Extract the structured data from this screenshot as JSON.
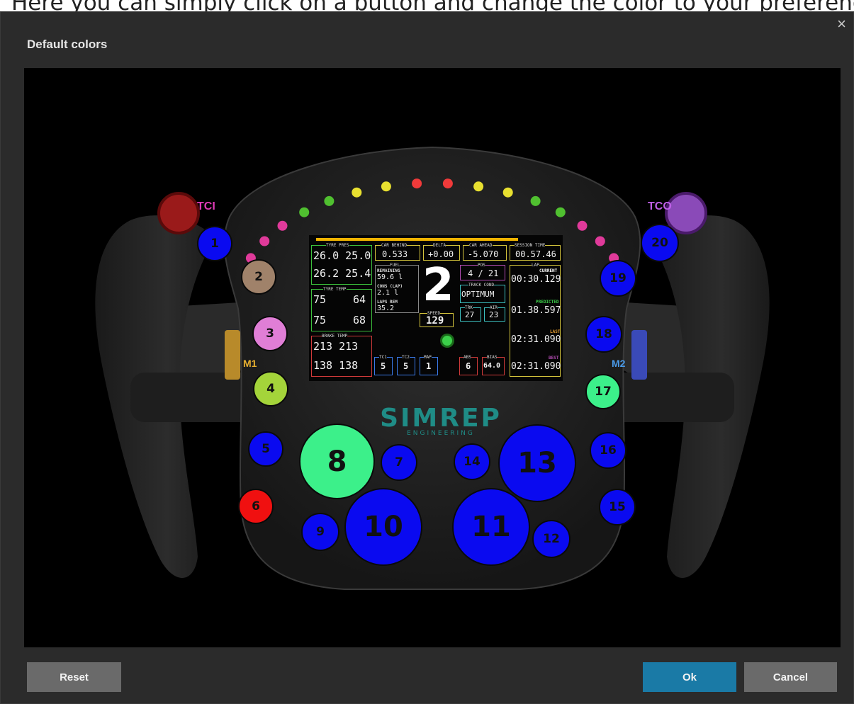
{
  "caption": "Here you can simply click on a button and change the color to your preference.",
  "dialog": {
    "title": "Default colors",
    "close": "×",
    "reset_label": "Reset",
    "ok_label": "Ok",
    "cancel_label": "Cancel",
    "ok_color": "#1a7aa6"
  },
  "labels": {
    "tci": "TCI",
    "tco": "TCO",
    "m1": "M1",
    "m2": "M2"
  },
  "buttons": [
    {
      "label": "1",
      "color": "#0a0af0"
    },
    {
      "label": "2",
      "color": "#a0826a"
    },
    {
      "label": "3",
      "color": "#e07ed6"
    },
    {
      "label": "4",
      "color": "#a4d43a"
    },
    {
      "label": "5",
      "color": "#0a0af0"
    },
    {
      "label": "6",
      "color": "#f01010"
    },
    {
      "label": "7",
      "color": "#0a0af0"
    },
    {
      "label": "8",
      "color": "#3cf08a"
    },
    {
      "label": "9",
      "color": "#0a0af0"
    },
    {
      "label": "10",
      "color": "#0a0af0"
    },
    {
      "label": "11",
      "color": "#0a0af0"
    },
    {
      "label": "12",
      "color": "#0a0af0"
    },
    {
      "label": "13",
      "color": "#0a0af0"
    },
    {
      "label": "14",
      "color": "#0a0af0"
    },
    {
      "label": "15",
      "color": "#0a0af0"
    },
    {
      "label": "16",
      "color": "#0a0af0"
    },
    {
      "label": "17",
      "color": "#3cf08a"
    },
    {
      "label": "18",
      "color": "#0a0af0"
    },
    {
      "label": "19",
      "color": "#0a0af0"
    },
    {
      "label": "20",
      "color": "#0a0af0"
    }
  ],
  "leds": [
    "#e03a9a",
    "#e03a9a",
    "#e03a9a",
    "#50c030",
    "#50c030",
    "#e8e030",
    "#e8e030",
    "#f03a3a",
    "#f03a3a",
    "#e8e030",
    "#e8e030",
    "#50c030",
    "#50c030",
    "#e03a9a",
    "#e03a9a",
    "#e03a9a"
  ],
  "screen": {
    "tyre_pres_label": "TYRE PRES",
    "tyre_pres": [
      "26.0 25.0",
      "26.2 25.4"
    ],
    "car_behind_label": "CAR BEHIND",
    "car_behind": "0.533",
    "delta_label": "DELTA",
    "delta": "+0.00",
    "car_ahead_label": "CAR AHEAD",
    "car_ahead": "-5.070",
    "session_time_label": "SESSION TIME",
    "session_time": "00.57.46",
    "fuel_label": "FUEL",
    "remaining_label": "REMAINING",
    "remaining": "59.6 l",
    "cons_label": "CONS (LAP)",
    "cons": "2.1 l",
    "laps_rem_label": "LAPS REM",
    "laps_rem": "35.2",
    "gear": "2",
    "speed_label": "SPEED",
    "speed": "129",
    "pos_label": "POS",
    "pos": "4 / 21",
    "track_cond_label": "TRACK COND",
    "track_cond": "OPTIMUM",
    "trk_label": "TRK",
    "trk": "27",
    "air_label": "AIR",
    "air": "23",
    "tyre_temp_label": "TYRE TEMP",
    "tyre_temp": [
      "75",
      "64",
      "75",
      "68"
    ],
    "brake_temp_label": "BRAKE TEMP",
    "brake_temp": [
      "213 213",
      "138 138"
    ],
    "lap_label": "LAP",
    "current_label": "CURRENT",
    "current": "00:30.129",
    "predicted_label": "PREDICTED",
    "predicted": "01.38.597",
    "last_label": "LAST",
    "last": "02:31.090",
    "best_label": "BEST",
    "best": "02:31.090",
    "tc1_label": "TC1",
    "tc1": "5",
    "tc2_label": "TC2",
    "tc2": "5",
    "map_label": "MAP",
    "map": "1",
    "abs_label": "ABS",
    "abs": "6",
    "bias_label": "BIAS",
    "bias": "64.0"
  },
  "logo": {
    "main": "SIMREP",
    "sub": "ENGINEERING"
  }
}
